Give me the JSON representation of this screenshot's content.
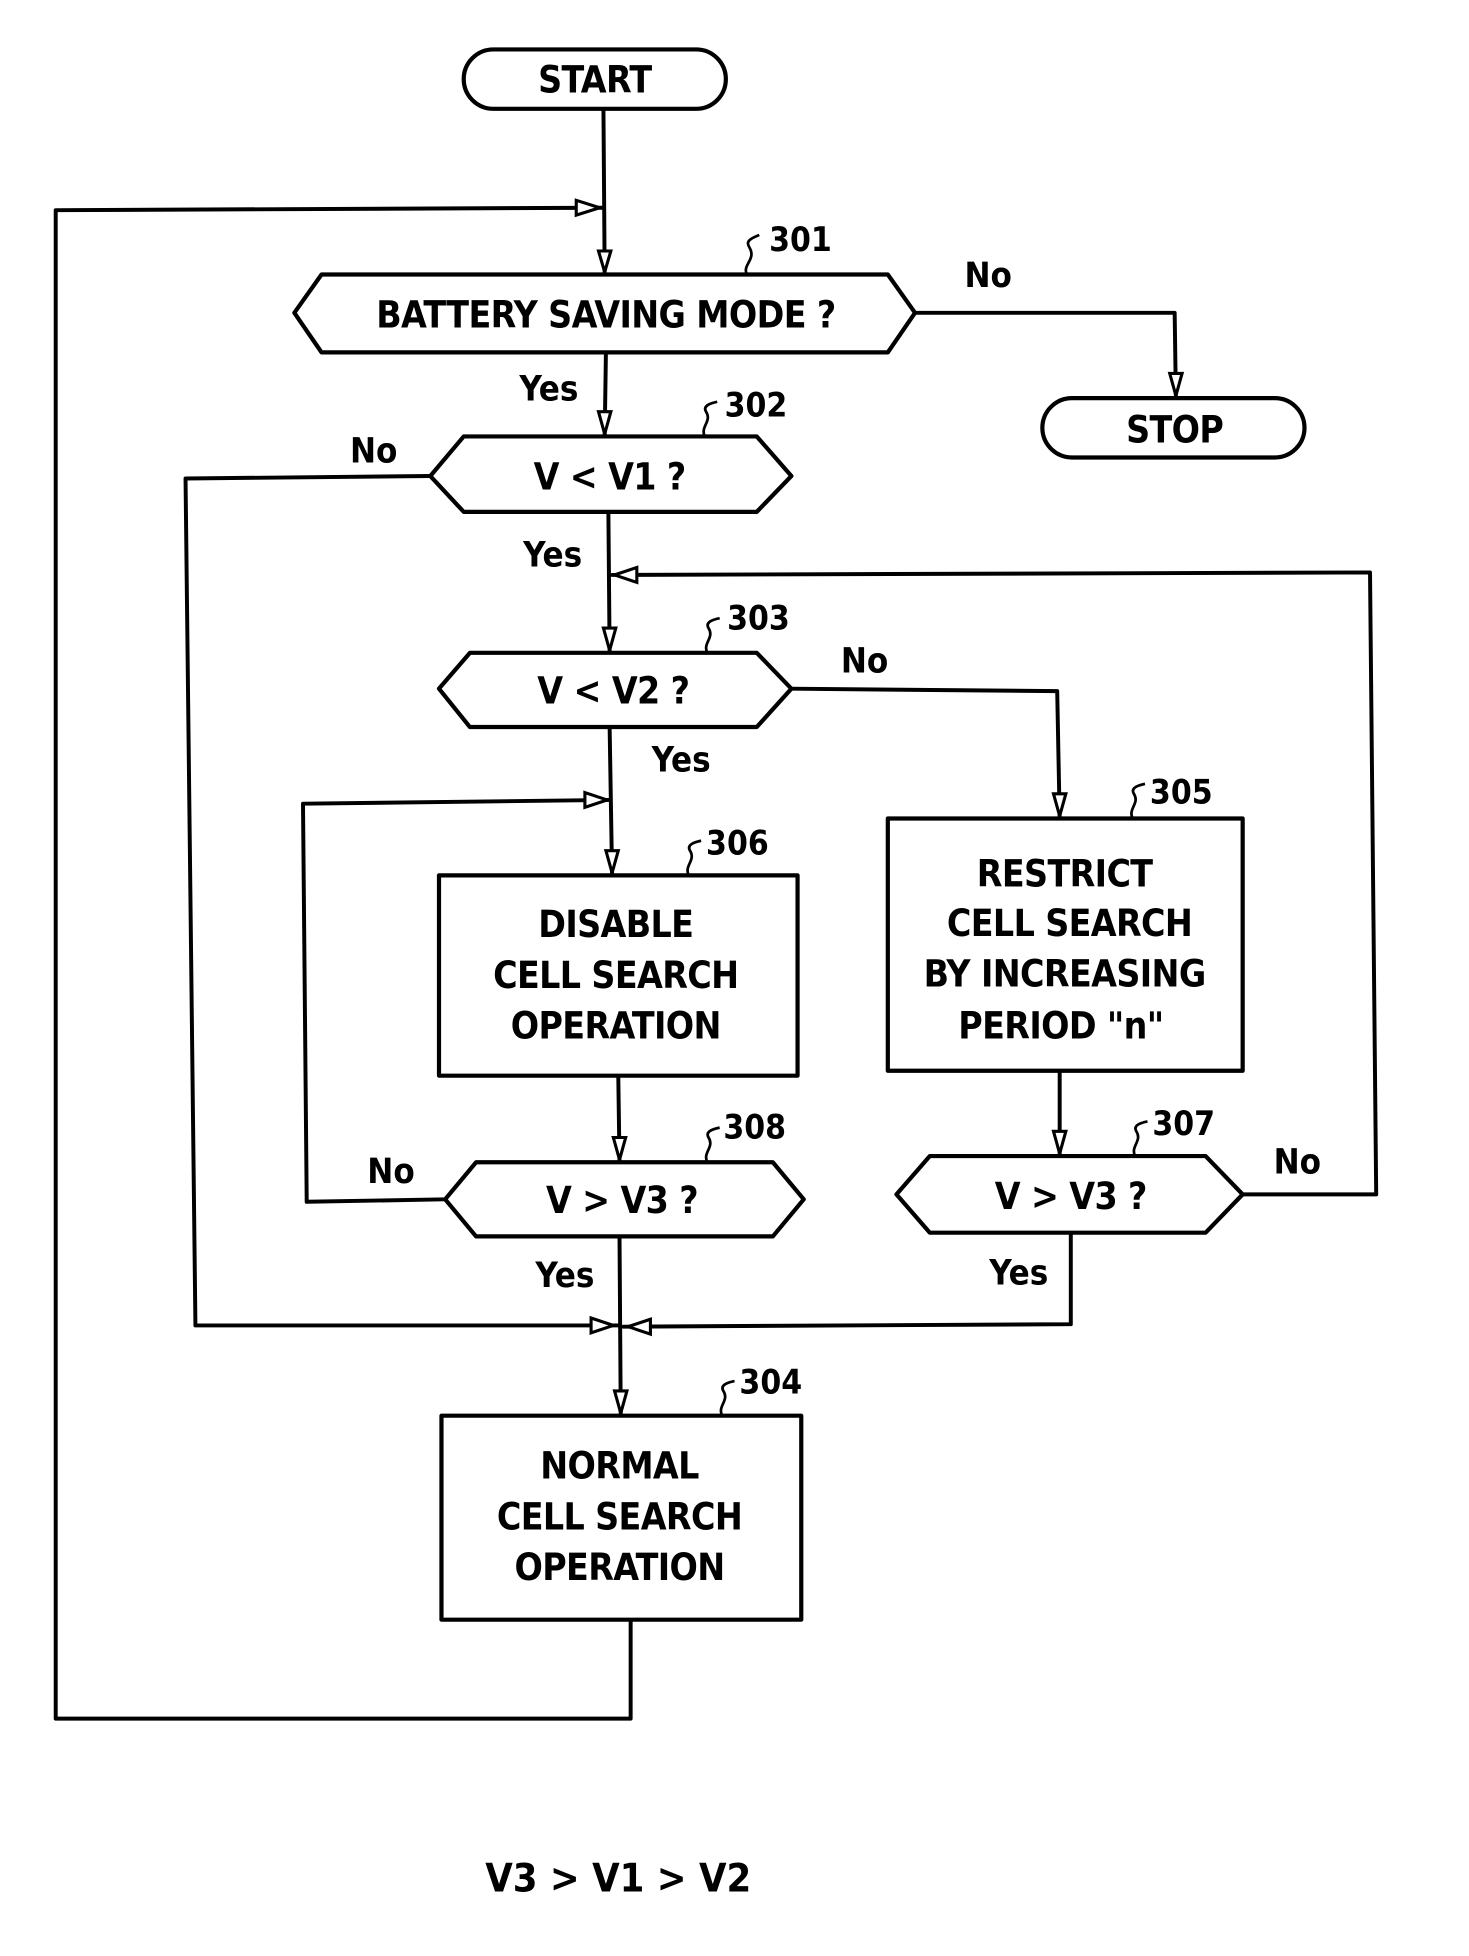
{
  "diagram": {
    "type": "flowchart",
    "terminals": {
      "start": "START",
      "stop": "STOP"
    },
    "steps": {
      "s301": {
        "ref": "301",
        "kind": "decision",
        "text": "BATTERY SAVING MODE ?"
      },
      "s302": {
        "ref": "302",
        "kind": "decision",
        "text": "V < V1 ?"
      },
      "s303": {
        "ref": "303",
        "kind": "decision",
        "text": "V < V2 ?"
      },
      "s304": {
        "ref": "304",
        "kind": "process",
        "lines": [
          "NORMAL",
          "CELL SEARCH",
          "OPERATION"
        ]
      },
      "s305": {
        "ref": "305",
        "kind": "process",
        "lines": [
          "RESTRICT",
          "CELL SEARCH",
          "BY INCREASING",
          "PERIOD \"n\""
        ]
      },
      "s306": {
        "ref": "306",
        "kind": "process",
        "lines": [
          "DISABLE",
          "CELL SEARCH",
          "OPERATION"
        ]
      },
      "s307": {
        "ref": "307",
        "kind": "decision",
        "text": "V > V3 ?"
      },
      "s308": {
        "ref": "308",
        "kind": "decision",
        "text": "V > V3 ?"
      }
    },
    "branch_labels": {
      "yes": "Yes",
      "no": "No"
    },
    "edges": [
      {
        "from": "start",
        "to": "s301"
      },
      {
        "from": "s301",
        "to": "s302",
        "label": "Yes"
      },
      {
        "from": "s301",
        "to": "stop",
        "label": "No"
      },
      {
        "from": "s302",
        "to": "s303",
        "label": "Yes"
      },
      {
        "from": "s302",
        "to": "s304",
        "label": "No"
      },
      {
        "from": "s303",
        "to": "s306",
        "label": "Yes"
      },
      {
        "from": "s303",
        "to": "s305",
        "label": "No"
      },
      {
        "from": "s306",
        "to": "s308"
      },
      {
        "from": "s308",
        "to": "s304",
        "label": "Yes"
      },
      {
        "from": "s308",
        "to": "s306",
        "label": "No"
      },
      {
        "from": "s305",
        "to": "s307"
      },
      {
        "from": "s307",
        "to": "s304",
        "label": "Yes"
      },
      {
        "from": "s307",
        "to": "s303",
        "label": "No"
      },
      {
        "from": "s304",
        "to": "s301"
      }
    ],
    "footnote": "V3 > V1 > V2"
  }
}
